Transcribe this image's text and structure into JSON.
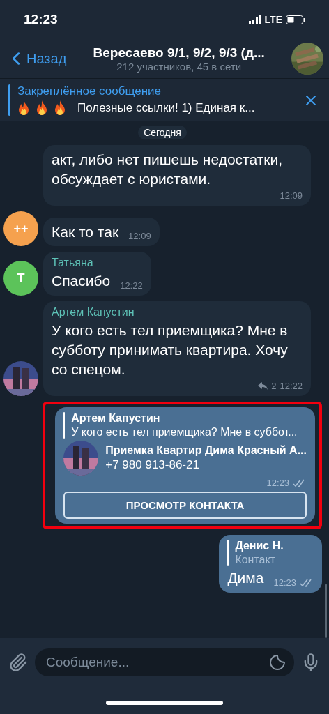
{
  "status_bar": {
    "time": "12:23",
    "network": "LTE"
  },
  "header": {
    "back": "Назад",
    "title": "Вересаево 9/1, 9/2, 9/3 (д...",
    "subtitle": "212 участников, 45 в сети"
  },
  "pinned": {
    "title": "Закреплённое сообщение",
    "icons": [
      {
        "kind": "fire"
      },
      {
        "kind": "fire"
      },
      {
        "kind": "fire"
      }
    ],
    "text": "Полезные ссылки!  1) Единая к..."
  },
  "date_label": "Сегодня",
  "messages": [
    {
      "kind": "text",
      "outgoing": false,
      "text": "акт, либо нет пишешь недостатки, обсуждает с юристами.",
      "time": "12:09"
    },
    {
      "kind": "text",
      "outgoing": false,
      "avatar": {
        "kind": "initials",
        "initials": "++",
        "color": "#f5a14e"
      },
      "text": "Как то так",
      "time": "12:09"
    },
    {
      "kind": "text",
      "outgoing": false,
      "avatar": {
        "kind": "initials",
        "initials": "Т",
        "color": "#5cc35a"
      },
      "sender": "Татьяна",
      "text": "Спасибо",
      "time": "12:22"
    },
    {
      "kind": "text",
      "outgoing": false,
      "sender": "Артем Капустин",
      "text": "У кого есть тел приемщика? Мне в субботу принимать квартира. Хочу со спецом.",
      "replies": "2",
      "time": "12:22"
    },
    {
      "kind": "contact",
      "outgoing": true,
      "highlighted": true,
      "reply": {
        "sender": "Артем Капустин",
        "text": "У кого есть тел приемщика? Мне в суббот..."
      },
      "contact": {
        "name": "Приемка Квартир Дима Красный А...",
        "phone": "+7 980 913-86-21"
      },
      "time": "12:23",
      "read": true,
      "button": "ПРОСМОТР КОНТАКТА"
    },
    {
      "kind": "text",
      "outgoing": true,
      "reply": {
        "sender": "Денис Н.",
        "text": "Контакт"
      },
      "text": "Дима",
      "time": "12:23",
      "read": true
    }
  ],
  "composer": {
    "placeholder": "Сообщение..."
  }
}
